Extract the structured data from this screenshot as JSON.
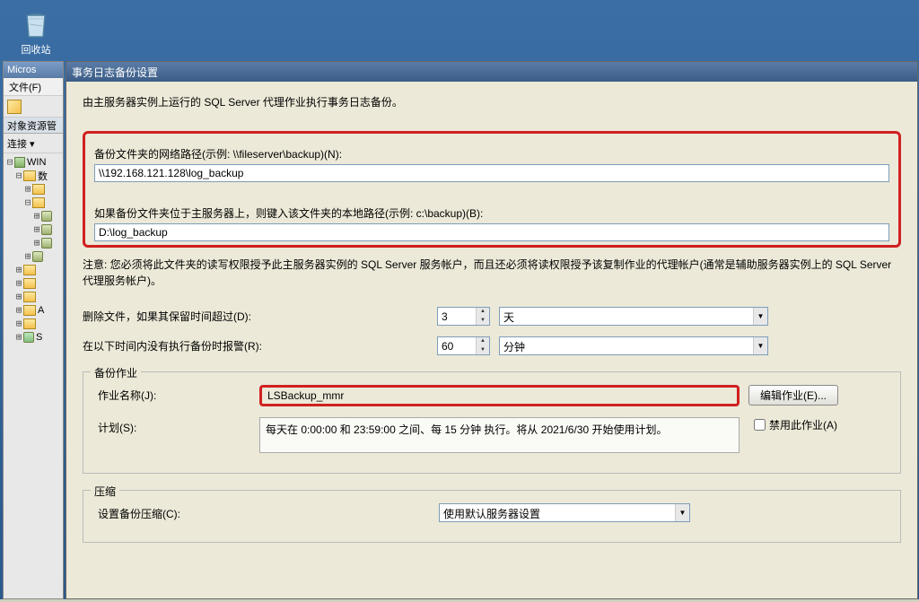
{
  "desktop": {
    "recycle_bin_label": "回收站"
  },
  "ssms": {
    "title": "Micros",
    "menu_file": "文件(F)",
    "panel_title": "对象资源管",
    "connect_label": "连接 ▾",
    "tree": {
      "server": "WIN",
      "folders": [
        "数",
        "",
        "",
        "",
        "",
        "",
        "",
        "",
        "",
        "",
        "A",
        "",
        "S"
      ]
    }
  },
  "dialog": {
    "title": "事务日志备份设置",
    "intro": "由主服务器实例上运行的 SQL Server 代理作业执行事务日志备份。",
    "network_path_label": "备份文件夹的网络路径(示例: \\\\fileserver\\backup)(N):",
    "network_path_value": "\\\\192.168.121.128\\log_backup",
    "local_path_label": "如果备份文件夹位于主服务器上，则键入该文件夹的本地路径(示例: c:\\backup)(B):",
    "local_path_value": "D:\\log_backup",
    "note": "注意: 您必须将此文件夹的读写权限授予此主服务器实例的 SQL Server 服务帐户，而且还必须将读权限授予该复制作业的代理帐户(通常是辅助服务器实例上的 SQL Server 代理服务帐户)。",
    "delete_label": "删除文件，如果其保留时间超过(D):",
    "delete_value": "3",
    "delete_unit": "天",
    "alert_label": "在以下时间内没有执行备份时报警(R):",
    "alert_value": "60",
    "alert_unit": "分钟",
    "backup_job": {
      "legend": "备份作业",
      "name_label": "作业名称(J):",
      "name_value": "LSBackup_mmr",
      "edit_button": "编辑作业(E)...",
      "schedule_label": "计划(S):",
      "schedule_value": "每天在 0:00:00 和 23:59:00 之间、每 15 分钟 执行。将从 2021/6/30 开始使用计划。",
      "disable_label": "禁用此作业(A)"
    },
    "compression": {
      "legend": "压缩",
      "label": "设置备份压缩(C):",
      "value": "使用默认服务器设置"
    }
  }
}
